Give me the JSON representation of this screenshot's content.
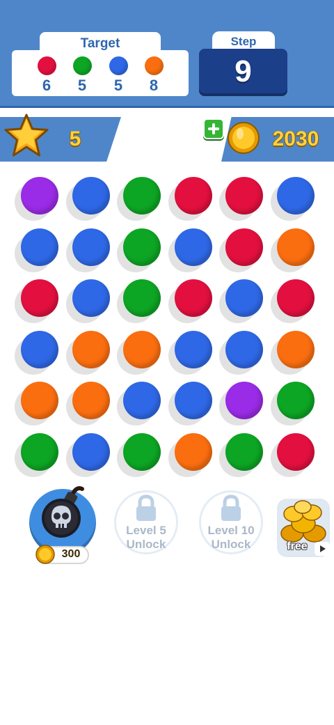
{
  "colors": {
    "red": "#e3103f",
    "green": "#0da524",
    "blue": "#2f68e6",
    "orange": "#fb6e10",
    "purple": "#9a2be6",
    "header_blue": "#4f86c9",
    "step_box": "#1c3f8a",
    "text_blue": "#2e66ad",
    "gold": "#ffd23f"
  },
  "header": {
    "target": {
      "title": "Target",
      "items": [
        {
          "color": "red",
          "count": "6"
        },
        {
          "color": "green",
          "count": "5"
        },
        {
          "color": "blue",
          "count": "5"
        },
        {
          "color": "orange",
          "count": "8"
        }
      ]
    },
    "step": {
      "label": "Step",
      "value": "9"
    }
  },
  "status_bar": {
    "stars": {
      "icon": "star-icon",
      "count": "5"
    },
    "coins": {
      "icon": "coin-icon",
      "plus_icon": "plus-icon",
      "count": "2030"
    }
  },
  "board": {
    "rows": [
      [
        "purple",
        "blue",
        "green",
        "red",
        "red",
        "blue"
      ],
      [
        "blue",
        "blue",
        "green",
        "blue",
        "red",
        "orange"
      ],
      [
        "red",
        "blue",
        "green",
        "red",
        "blue",
        "red"
      ],
      [
        "blue",
        "orange",
        "orange",
        "blue",
        "blue",
        "orange"
      ],
      [
        "orange",
        "orange",
        "blue",
        "blue",
        "purple",
        "green"
      ],
      [
        "green",
        "blue",
        "green",
        "orange",
        "green",
        "red"
      ]
    ]
  },
  "boosters": {
    "bomb": {
      "icon": "bomb-skull-icon",
      "price": "300"
    },
    "locked_1": {
      "icon": "lock-icon",
      "line1": "Level 5",
      "line2": "Unlock"
    },
    "locked_2": {
      "icon": "lock-icon",
      "line1": "Level 10",
      "line2": "Unlock"
    },
    "free_coins": {
      "icon": "coin-pile-icon",
      "label": "free",
      "badge_icon": "play-icon"
    }
  }
}
